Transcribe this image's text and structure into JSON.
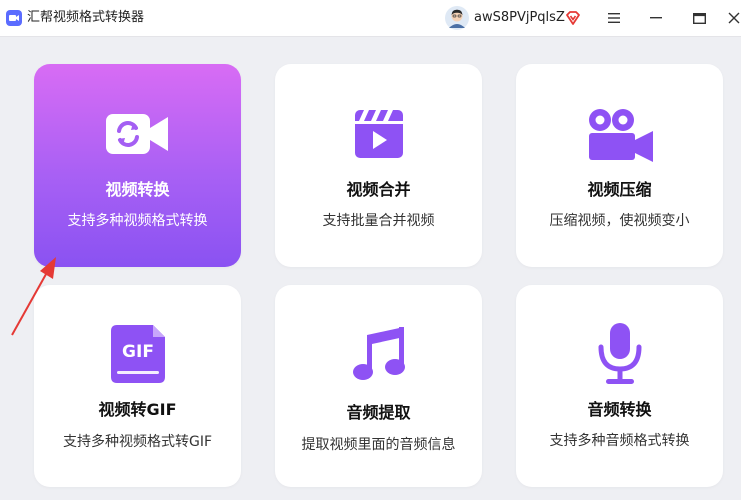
{
  "app": {
    "title": "汇帮视频格式转换器"
  },
  "user": {
    "name": "awS8PVjPqlsZ"
  },
  "colors": {
    "accent": "#8e52f4",
    "active_gradient_top": "#d86cf4",
    "active_gradient_bottom": "#8a52f2",
    "arrow": "#e53935"
  },
  "cards": [
    {
      "title": "视频转换",
      "desc": "支持多种视频格式转换",
      "icon": "video-convert-icon"
    },
    {
      "title": "视频合并",
      "desc": "支持批量合并视频",
      "icon": "clapperboard-icon"
    },
    {
      "title": "视频压缩",
      "desc": "压缩视频，使视频变小",
      "icon": "video-camera-icon"
    },
    {
      "title": "视频转GIF",
      "desc": "支持多种视频格式转GIF",
      "icon": "gif-file-icon",
      "icon_label": "GIF"
    },
    {
      "title": "音频提取",
      "desc": "提取视频里面的音频信息",
      "icon": "music-note-icon"
    },
    {
      "title": "音频转换",
      "desc": "支持多种音频格式转换",
      "icon": "microphone-icon"
    }
  ]
}
